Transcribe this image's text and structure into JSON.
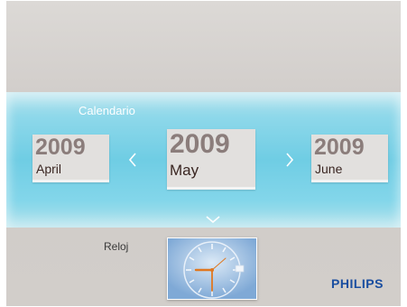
{
  "calendar": {
    "title": "Calendario",
    "prev": {
      "year": "2009",
      "month": "April"
    },
    "current": {
      "year": "2009",
      "month": "May"
    },
    "next": {
      "year": "2009",
      "month": "June"
    }
  },
  "clock": {
    "label": "Reloj"
  },
  "brand": "PHILIPS",
  "colors": {
    "band": "#6fcde4",
    "year_text": "#8b7d7b",
    "month_text": "#3a2622",
    "brand": "#1a4ea0",
    "clock_hand": "#e07820"
  },
  "icons": {
    "prev": "chevron-left-icon",
    "next": "chevron-right-icon",
    "down": "chevron-down-icon"
  }
}
